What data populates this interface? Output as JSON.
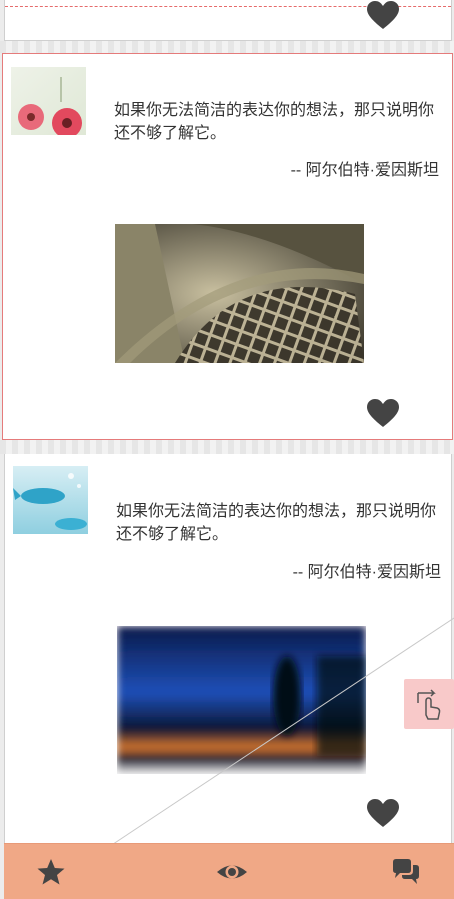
{
  "feed": {
    "posts": [
      {
        "quote": "如果你无法简洁的表达你的想法，那只说明你还不够了解它。",
        "author": "-- 阿尔伯特·爱因斯坦"
      },
      {
        "quote": "如果你无法简洁的表达你的想法，那只说明你还不够了解它。",
        "author": "-- 阿尔伯特·爱因斯坦"
      }
    ]
  },
  "icons": {
    "like": "heart-icon",
    "nav_favorites": "star-icon",
    "nav_views": "eye-icon",
    "nav_comments": "comments-icon",
    "floating": "touch-swipe-icon"
  },
  "colors": {
    "bottom_bar": "#f0a886",
    "active_border": "#e57b7b",
    "floating_button": "#f8c9c9",
    "icon": "#444444"
  }
}
